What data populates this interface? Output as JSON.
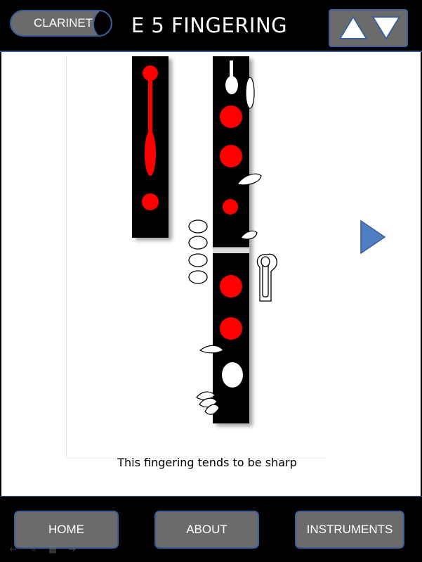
{
  "header": {
    "instrument_label": "CLARINET",
    "title": "E 5 FINGERING",
    "nav_up_icon": "triangle-up-icon",
    "nav_down_icon": "triangle-down-icon"
  },
  "diagram": {
    "note": "This fingering tends to be sharp",
    "next_icon": "play-right-icon",
    "colors": {
      "pressed": "#ff0000",
      "body": "#000000",
      "key": "#ffffff",
      "accent": "#4f7fc2"
    }
  },
  "footer": {
    "home_label": "HOME",
    "about_label": "ABOUT",
    "instruments_label": "INSTRUMENTS"
  },
  "toolbar_icons": [
    "back-arrow-icon",
    "pen-icon",
    "screen-icon",
    "forward-arrow-icon"
  ]
}
